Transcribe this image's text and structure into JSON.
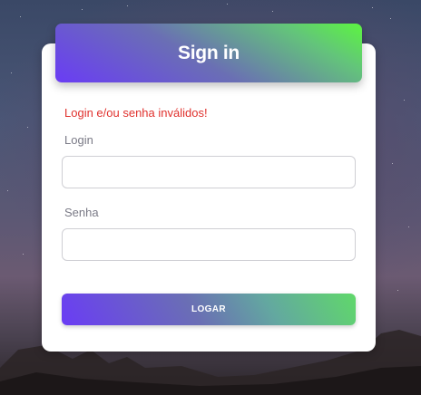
{
  "header": {
    "title": "Sign in"
  },
  "form": {
    "error_message": "Login e/ou senha inválidos!",
    "login_label": "Login",
    "login_value": "",
    "password_label": "Senha",
    "password_value": "",
    "submit_label": "LOGAR"
  },
  "colors": {
    "error": "#e0322e",
    "gradient_start": "#6a3cf5",
    "gradient_end": "#5cf540"
  }
}
